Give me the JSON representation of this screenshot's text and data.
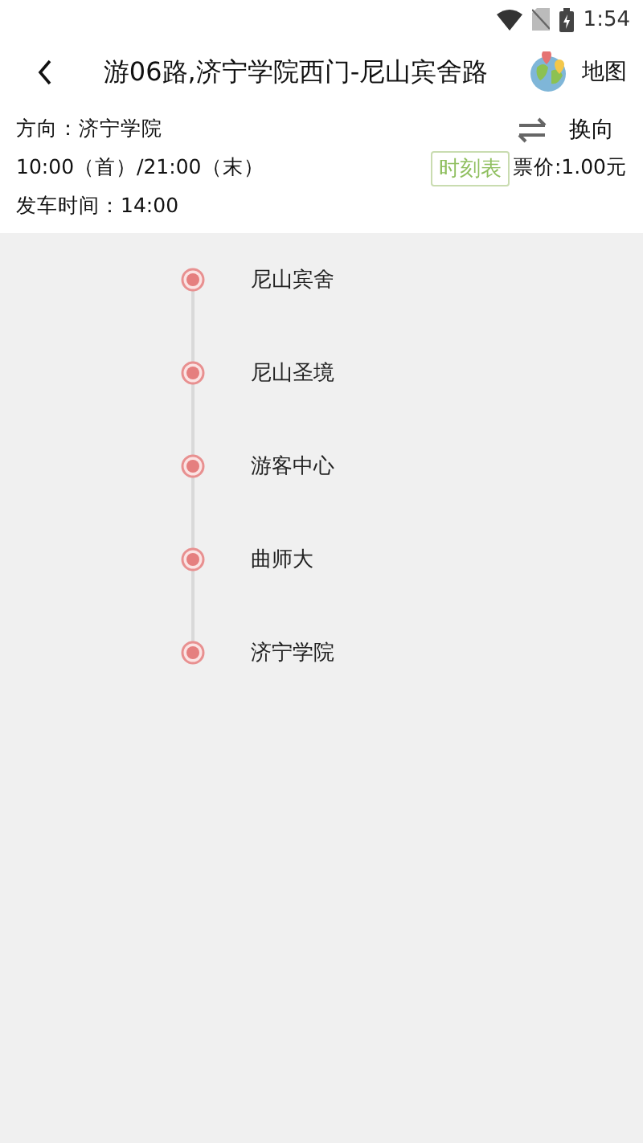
{
  "status_bar": {
    "time": "1:54"
  },
  "header": {
    "title": "游06路,济宁学院西门-尼山宾舍路",
    "map_label": "地图"
  },
  "info": {
    "direction": "方向：济宁学院",
    "swap_label": "换向",
    "hours": "10:00（首）/21:00（末）",
    "timetable_label": "时刻表",
    "fare": "票价:1.00元",
    "departure": "发车时间：14:00"
  },
  "stops": [
    {
      "name": "尼山宾舍"
    },
    {
      "name": "尼山圣境"
    },
    {
      "name": "游客中心"
    },
    {
      "name": "曲师大"
    },
    {
      "name": "济宁学院"
    }
  ]
}
